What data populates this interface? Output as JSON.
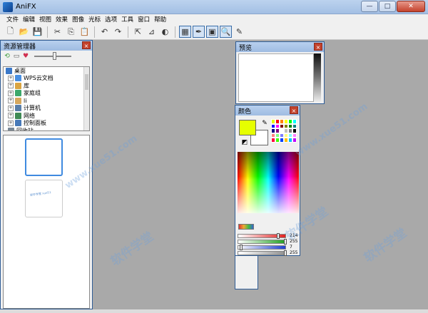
{
  "window": {
    "title": "AniFX",
    "minimize": "—",
    "maximize": "□",
    "close": "✕"
  },
  "menu": [
    "文件",
    "编辑",
    "视图",
    "效果",
    "图像",
    "光标",
    "选项",
    "工具",
    "窗口",
    "帮助"
  ],
  "toolbar": {
    "icons": [
      "new-icon",
      "open-icon",
      "save-icon",
      "sep",
      "cut-icon",
      "copy-icon",
      "paste-icon",
      "sep",
      "undo-icon",
      "redo-icon",
      "sep",
      "select-icon",
      "crop-icon",
      "circle-icon",
      "sep",
      "grid-icon",
      "tools-icon",
      "screen-icon",
      "zoom-icon",
      "brush-icon"
    ],
    "glyphs": [
      "🗋",
      "📂",
      "💾",
      "",
      "✂",
      "⎘",
      "📋",
      "",
      "↶",
      "↷",
      "",
      "⇱",
      "⊿",
      "◐",
      "",
      "▦",
      "✒",
      "▣",
      "🔍",
      "✎"
    ]
  },
  "explorer": {
    "title": "资源管理器",
    "close": "×",
    "tree": [
      {
        "label": "桌面",
        "color": "#3a78c9",
        "toggle": ""
      },
      {
        "label": "WPS云文档",
        "color": "#4a90e2",
        "toggle": "+"
      },
      {
        "label": "库",
        "color": "#d9a441",
        "toggle": "+"
      },
      {
        "label": "家庭组",
        "color": "#3ca86b",
        "toggle": "+"
      },
      {
        "label": "li",
        "color": "#d7a85d",
        "toggle": "+"
      },
      {
        "label": "计算机",
        "color": "#5a7fa8",
        "toggle": "+"
      },
      {
        "label": "网络",
        "color": "#3f8a54",
        "toggle": "+"
      },
      {
        "label": "控制面板",
        "color": "#4779b8",
        "toggle": "+"
      },
      {
        "label": "回收站",
        "color": "#7a8896",
        "toggle": ""
      }
    ],
    "thumb_caption": "软件学堂 xue51"
  },
  "preview": {
    "title": "预览",
    "close": "×"
  },
  "colors": {
    "title": "颜色",
    "close": "×",
    "current": "#e6ff00",
    "swatches": [
      "#e6ff00",
      "#ff0000",
      "#ff8000",
      "#ffff00",
      "#00ff00",
      "#00ffff",
      "#0000ff",
      "#ff00ff",
      "#800000",
      "#808000",
      "#008000",
      "#008080",
      "#000080",
      "#800080",
      "#ffffff",
      "#c0c0c0",
      "#808080",
      "#000000",
      "#ff8080",
      "#80ff80",
      "#8080ff",
      "#ffff80",
      "#80ffff",
      "#ff80ff",
      "#ff0040",
      "#40ff00",
      "#0040ff",
      "#ffc000",
      "#00c0ff",
      "#c000ff"
    ],
    "sliders": [
      {
        "name": "red",
        "value": "214",
        "color": "#e02020",
        "fill": 0.84
      },
      {
        "name": "green",
        "value": "255",
        "color": "#20a020",
        "fill": 1.0
      },
      {
        "name": "blue",
        "value": "7",
        "color": "#2040d0",
        "fill": 0.03
      },
      {
        "name": "alpha",
        "value": "255",
        "color": "#909090",
        "fill": 1.0
      }
    ]
  },
  "watermark": [
    "软件学堂",
    "www.xue51.com"
  ]
}
